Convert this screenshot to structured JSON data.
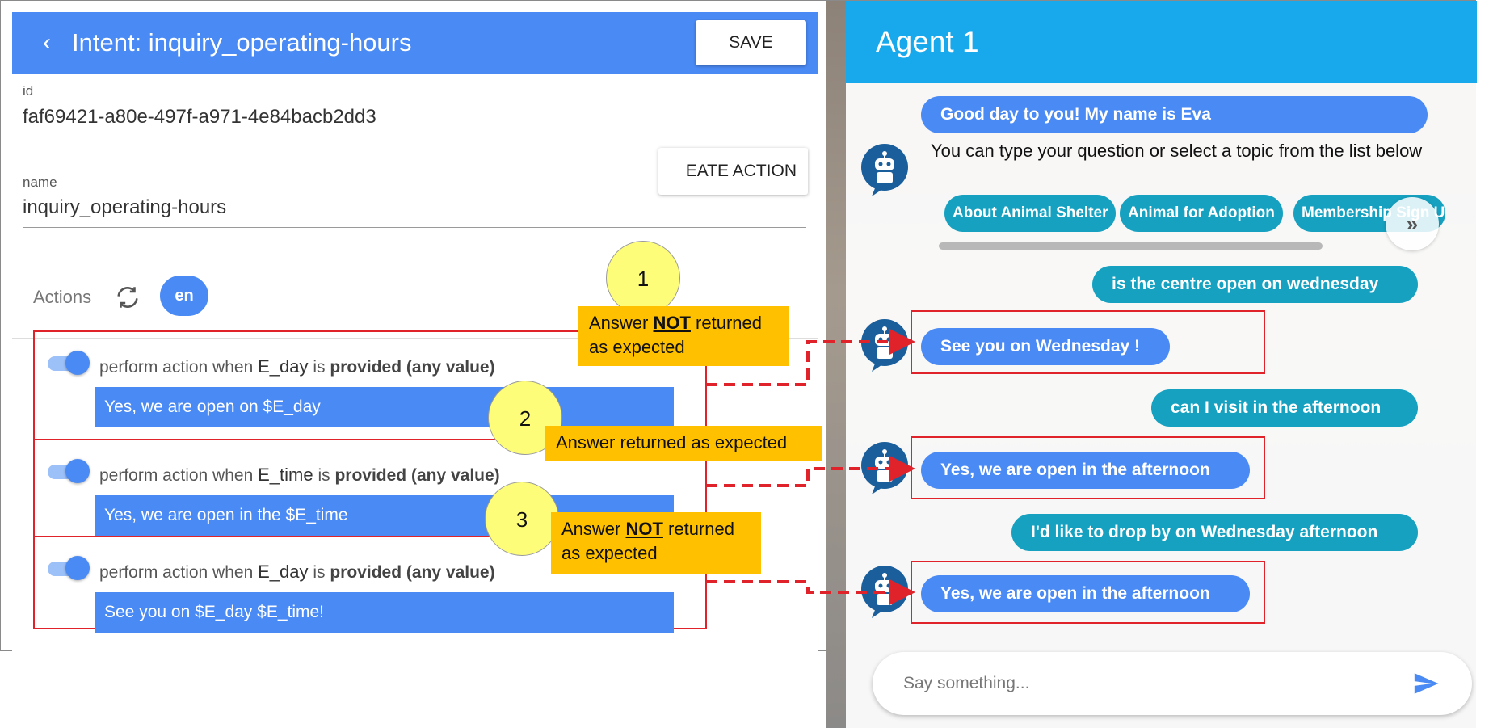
{
  "intent_editor": {
    "title": "Intent: inquiry_operating-hours",
    "back_icon": "chevron-left-icon",
    "save_label": "SAVE",
    "id_label": "id",
    "id_value": "faf69421-a80e-497f-a971-4e84bacb2dd3",
    "name_label": "name",
    "name_value": "inquiry_operating-hours",
    "actions_label": "Actions",
    "language_chip": "en",
    "create_action_label": "EATE ACTION",
    "actions": [
      {
        "prefix": "perform action when",
        "entity": "E_day",
        "middle": "is",
        "condition": "provided (any value)",
        "response": "Yes, we are open on $E_day",
        "enabled": true
      },
      {
        "prefix": "perform action when",
        "entity": "E_time",
        "middle": "is",
        "condition": "provided (any value)",
        "response": "Yes, we are open in the $E_time",
        "enabled": true
      },
      {
        "prefix": "perform action when",
        "entity": "E_day",
        "middle": "is",
        "condition": "provided (any value)",
        "response": "See you on $E_day $E_time!",
        "enabled": true
      }
    ]
  },
  "chat": {
    "title": "Agent 1",
    "greeting": "Good day to you! My name is Eva",
    "intro_text": "You can type your question or select a topic from the list below",
    "topics": [
      "About Animal Shelter",
      "Animal for Adoption",
      "Membership Sign Up"
    ],
    "topic_next_label": "»",
    "messages": [
      {
        "from": "user",
        "text": "is the centre open on wednesday"
      },
      {
        "from": "bot",
        "text": "See you on Wednesday !"
      },
      {
        "from": "user",
        "text": "can I visit in the afternoon"
      },
      {
        "from": "bot",
        "text": "Yes, we are open in the afternoon"
      },
      {
        "from": "user",
        "text": "I'd like to drop by on Wednesday afternoon"
      },
      {
        "from": "bot",
        "text": "Yes, we are open in the afternoon"
      }
    ],
    "input_placeholder": "Say something...",
    "send_icon": "send-icon"
  },
  "annotations": [
    {
      "number": "1",
      "pre": "Answer ",
      "emph": "NOT",
      "post": " returned as expected"
    },
    {
      "number": "2",
      "pre": "Answer returned as expected",
      "emph": "",
      "post": ""
    },
    {
      "number": "3",
      "pre": "Answer ",
      "emph": "NOT",
      "post": " returned as expected"
    }
  ],
  "colors": {
    "primary_blue": "#4a8af4",
    "header_cyan": "#17a9ec",
    "user_bubble": "#16a1c0",
    "highlight_red": "#e0222b",
    "note_orange": "#ffc000",
    "circle_yellow": "#fdfd7a"
  }
}
